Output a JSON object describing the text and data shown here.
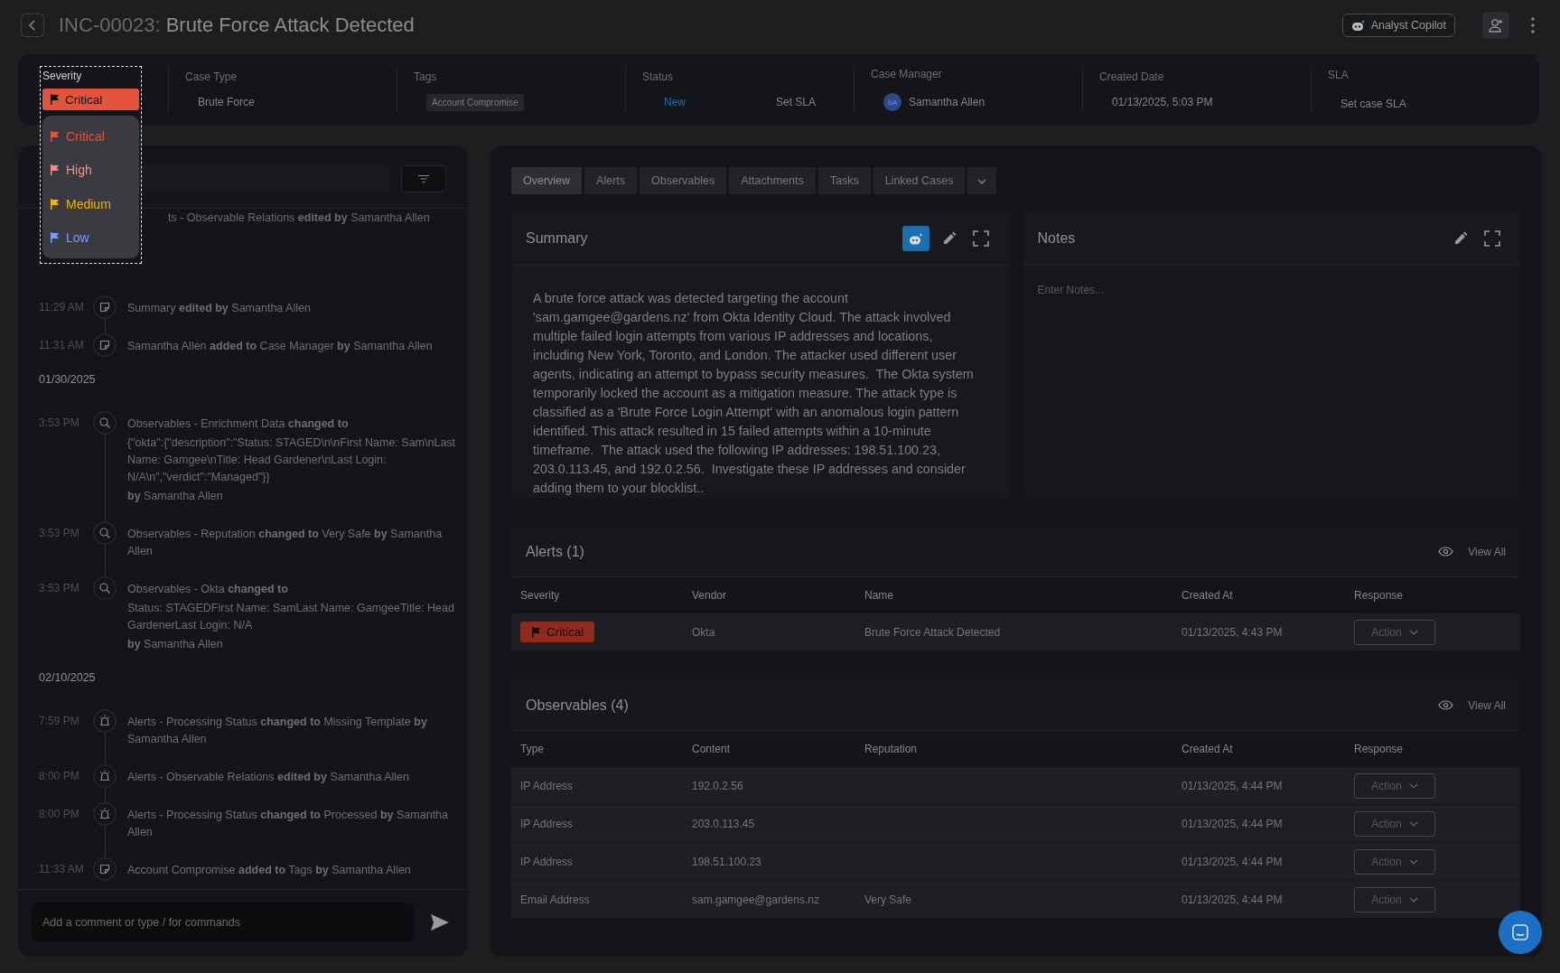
{
  "header": {
    "case_id": "INC-00023:",
    "title": "Brute Force Attack Detected",
    "copilot_button": "Analyst Copilot"
  },
  "info": {
    "severity": {
      "label": "Severity",
      "value": "Critical",
      "options": [
        {
          "label": "Critical",
          "color": "#e8503a"
        },
        {
          "label": "High",
          "color": "#f28b8b"
        },
        {
          "label": "Medium",
          "color": "#f5b301"
        },
        {
          "label": "Low",
          "color": "#7a9bff"
        }
      ]
    },
    "case_type": {
      "label": "Case Type",
      "value": "Brute Force"
    },
    "tags": {
      "label": "Tags",
      "items": [
        "Account Compromise"
      ]
    },
    "status": {
      "label": "Status",
      "value": "New",
      "sla_link": "Set SLA"
    },
    "case_manager": {
      "label": "Case Manager",
      "initials": "SA",
      "name": "Samantha Allen"
    },
    "created_date": {
      "label": "Created Date",
      "value": "01/13/2025, 5:03 PM"
    },
    "sla": {
      "label": "SLA",
      "value": "Set case SLA"
    }
  },
  "activity": {
    "cut_entry": "ts - Observable Relations **edited by** Samantha Allen",
    "entries": [
      {
        "kind": "note",
        "time": "11:29 AM",
        "lines": [
          "Summary **edited by** Samantha Allen"
        ]
      },
      {
        "kind": "note",
        "time": "11:31 AM",
        "lines": [
          "Samantha Allen **added to** Case Manager **by** Samantha Allen"
        ]
      },
      {
        "kind": "date",
        "text": "01/30/2025"
      },
      {
        "kind": "search",
        "time": "3:53 PM",
        "lines": [
          "Observables - Enrichment Data **changed to**",
          "{\"okta\":{\"description\":\"Status: STAGED\\n\\nFirst Name: Sam\\nLast Name: Gamgee\\nTitle: Head Gardener\\nLast Login: N/A\\n\",\"verdict\":\"Managed\"}}",
          "**by** Samantha Allen"
        ]
      },
      {
        "kind": "search",
        "time": "3:53 PM",
        "lines": [
          "Observables - Reputation **changed to** Very Safe **by** Samantha Allen"
        ]
      },
      {
        "kind": "search",
        "time": "3:53 PM",
        "lines": [
          "Observables - Okta **changed to**",
          "Status: STAGEDFirst Name: SamLast Name: GamgeeTitle: Head GardenerLast Login: N/A",
          "**by** Samantha Allen"
        ]
      },
      {
        "kind": "date",
        "text": "02/10/2025"
      },
      {
        "kind": "alarm",
        "time": "7:59 PM",
        "lines": [
          "Alerts - Processing Status **changed to** Missing Template **by** Samantha Allen"
        ]
      },
      {
        "kind": "alarm",
        "time": "8:00 PM",
        "lines": [
          "Alerts - Observable Relations **edited by** Samantha Allen"
        ]
      },
      {
        "kind": "alarm",
        "time": "8:00 PM",
        "lines": [
          "Alerts - Processing Status **changed to** Processed **by** Samantha Allen"
        ]
      },
      {
        "kind": "note",
        "time": "11:33 AM",
        "lines": [
          "Account Compromise **added to** Tags **by** Samantha Allen"
        ]
      }
    ],
    "comment_placeholder": "Add a comment or type / for commands"
  },
  "tabs": [
    {
      "label": "Overview",
      "selected": true
    },
    {
      "label": "Alerts",
      "selected": false
    },
    {
      "label": "Observables",
      "selected": false
    },
    {
      "label": "Attachments",
      "selected": false
    },
    {
      "label": "Tasks",
      "selected": false
    },
    {
      "label": "Linked Cases",
      "selected": false
    }
  ],
  "summary": {
    "title": "Summary",
    "text": "A brute force attack was detected targeting the account 'sam.gamgee@gardens.nz' from Okta Identity Cloud. The attack involved multiple failed login attempts from various IP addresses and locations, including New York, Toronto, and London. The attacker used different user agents, indicating an attempt to bypass security measures.  The Okta system temporarily locked the account as a mitigation measure. The attack type is classified as a 'Brute Force Login Attempt' with an anomalous login pattern identified. This attack resulted in 15 failed attempts within a 10-minute timeframe.  The attack used the following IP addresses: 198.51.100.23, 203.0.113.45, and 192.0.2.56.  Investigate these IP addresses and consider adding them to your blocklist.."
  },
  "notes": {
    "title": "Notes",
    "placeholder": "Enter Notes..."
  },
  "alerts": {
    "title": "Alerts (1)",
    "view_all": "View All",
    "columns": [
      "Severity",
      "Vendor",
      "Name",
      "Created At",
      "Response"
    ],
    "rows": [
      {
        "severity": "Critical",
        "vendor": "Okta",
        "name": "Brute Force Attack Detected",
        "created_at": "01/13/2025, 4:43 PM",
        "action": "Action"
      }
    ]
  },
  "observables": {
    "title": "Observables (4)",
    "view_all": "View All",
    "columns": [
      "Type",
      "Content",
      "Reputation",
      "Created At",
      "Response"
    ],
    "rows": [
      {
        "type": "IP Address",
        "content": "192.0.2.56",
        "created_at": "01/13/2025, 4:44 PM",
        "action": "Action"
      },
      {
        "type": "IP Address",
        "content": "203.0.113.45",
        "created_at": "01/13/2025, 4:44 PM",
        "action": "Action"
      },
      {
        "type": "IP Address",
        "content": "198.51.100.23",
        "created_at": "01/13/2025, 4:44 PM",
        "action": "Action"
      },
      {
        "type": "Email Address",
        "content": "sam.gamgee@gardens.nz",
        "reputation": "Very Safe",
        "created_at": "01/13/2025, 4:44 PM",
        "action": "Action"
      }
    ]
  }
}
